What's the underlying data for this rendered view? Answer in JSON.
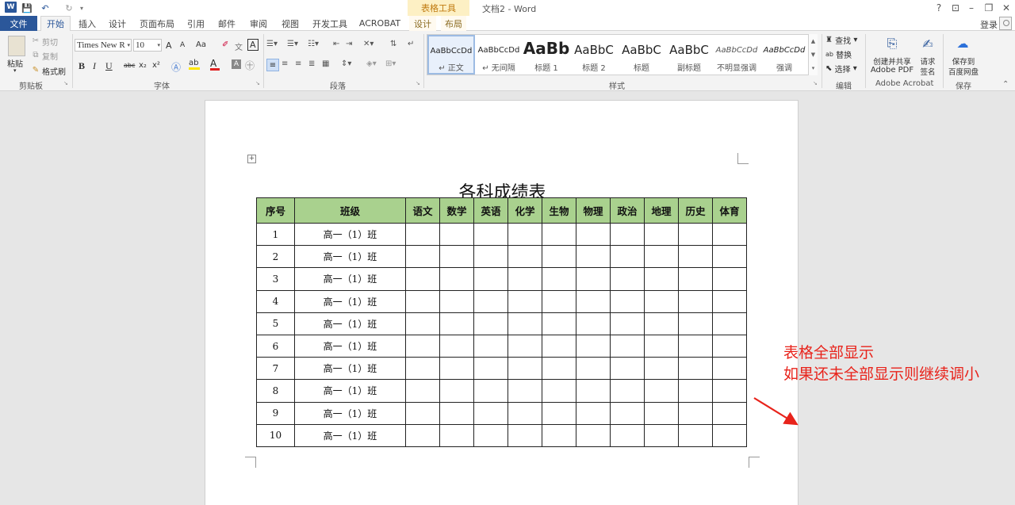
{
  "titlebar": {
    "doc_title": "文档2 - Word",
    "context_group": "表格工具",
    "help": "?",
    "logo": "W",
    "qa_save": "💾",
    "qa_undo": "↶",
    "qa_redo": "↻"
  },
  "tabs": {
    "file": "文件",
    "items": [
      "开始",
      "插入",
      "设计",
      "页面布局",
      "引用",
      "邮件",
      "审阅",
      "视图",
      "开发工具",
      "ACROBAT"
    ],
    "context": [
      "设计",
      "布局"
    ],
    "active": "开始",
    "login": "登录"
  },
  "ribbon": {
    "clipboard": {
      "paste": "粘贴",
      "cut": "剪切",
      "copy": "复制",
      "format_painter": "格式刷",
      "label": "剪贴板"
    },
    "font": {
      "font_name": "Times New R",
      "font_size": "10",
      "label": "字体",
      "bold": "B",
      "italic": "I",
      "underline": "U",
      "strike": "abc",
      "sub": "x₂",
      "sup": "x²",
      "grow": "A",
      "shrink": "A",
      "case": "Aa",
      "clear": "A"
    },
    "paragraph": {
      "label": "段落"
    },
    "styles": {
      "label": "样式",
      "items": [
        {
          "sample": "AaBbCcDd",
          "name": "↵ 正文"
        },
        {
          "sample": "AaBbCcDd",
          "name": "↵ 无间隔"
        },
        {
          "sample": "AaBb",
          "name": "标题 1"
        },
        {
          "sample": "AaBbC",
          "name": "标题 2"
        },
        {
          "sample": "AaBbC",
          "name": "标题"
        },
        {
          "sample": "AaBbC",
          "name": "副标题"
        },
        {
          "sample": "AaBbCcDd",
          "name": "不明显强调"
        },
        {
          "sample": "AaBbCcDd",
          "name": "强调"
        }
      ]
    },
    "editing": {
      "find": "查找",
      "replace": "替换",
      "select": "选择",
      "label": "编辑"
    },
    "acrobat": {
      "create_pdf_line1": "创建并共享",
      "create_pdf_line2": "Adobe PDF",
      "request_line1": "请求",
      "request_line2": "签名",
      "label": "Adobe Acrobat"
    },
    "save": {
      "line1": "保存到",
      "line2": "百度网盘",
      "label": "保存"
    }
  },
  "document": {
    "title": "各科成绩表",
    "headers": [
      "序号",
      "班级",
      "语文",
      "数学",
      "英语",
      "化学",
      "生物",
      "物理",
      "政治",
      "地理",
      "历史",
      "体育"
    ],
    "rows": [
      [
        "1",
        "高一（1）班"
      ],
      [
        "2",
        "高一（1）班"
      ],
      [
        "3",
        "高一（1）班"
      ],
      [
        "4",
        "高一（1）班"
      ],
      [
        "5",
        "高一（1）班"
      ],
      [
        "6",
        "高一（1）班"
      ],
      [
        "7",
        "高一（1）班"
      ],
      [
        "8",
        "高一（1）班"
      ],
      [
        "9",
        "高一（1）班"
      ],
      [
        "10",
        "高一（1）班"
      ]
    ]
  },
  "annotation": {
    "line1": "表格全部显示",
    "line2": "如果还未全部显示则继续调小",
    "color": "#e8231b"
  },
  "colors": {
    "word_blue": "#2b579a",
    "header_green": "#a9d18e",
    "context_tab": "#fdf0c4"
  }
}
